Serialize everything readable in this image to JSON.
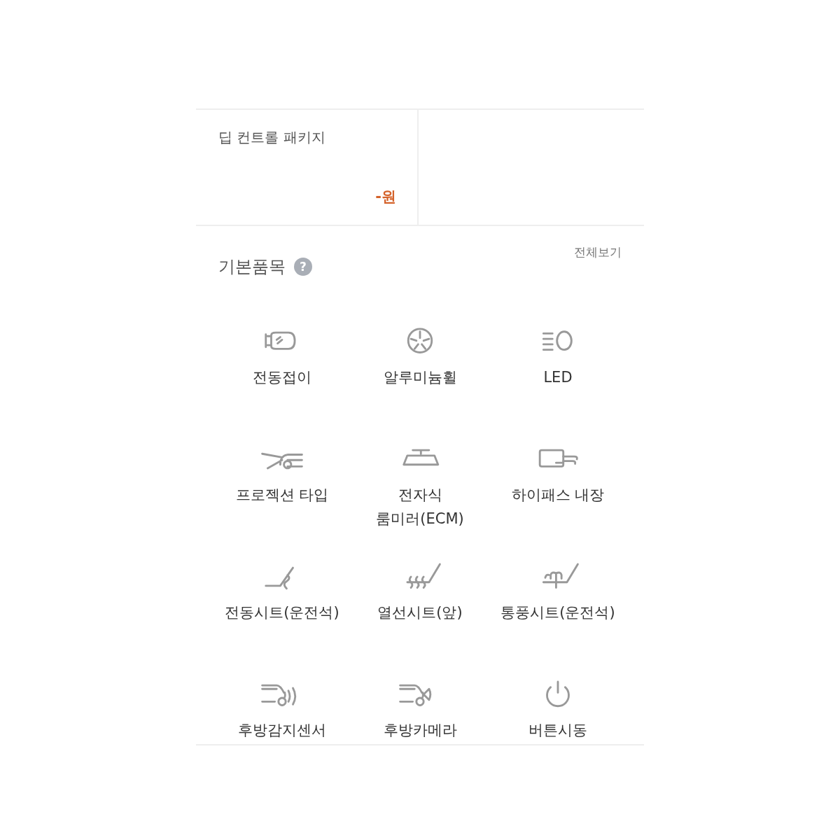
{
  "package": {
    "title": "딥 컨트롤 패키지",
    "price": "-원"
  },
  "section": {
    "title": "기본품목",
    "help": "?",
    "view_all": "전체보기"
  },
  "items": [
    {
      "label": "전동접이"
    },
    {
      "label": "알루미늄휠"
    },
    {
      "label": "LED"
    },
    {
      "label": "프로젝션 타입"
    },
    {
      "label": "전자식\n룸미러(ECM)"
    },
    {
      "label": "하이패스 내장"
    },
    {
      "label": "전동시트(운전석)"
    },
    {
      "label": "열선시트(앞)"
    },
    {
      "label": "통풍시트(운전석)"
    },
    {
      "label": "후방감지센서"
    },
    {
      "label": "후방카메라"
    },
    {
      "label": "버튼시동"
    }
  ]
}
